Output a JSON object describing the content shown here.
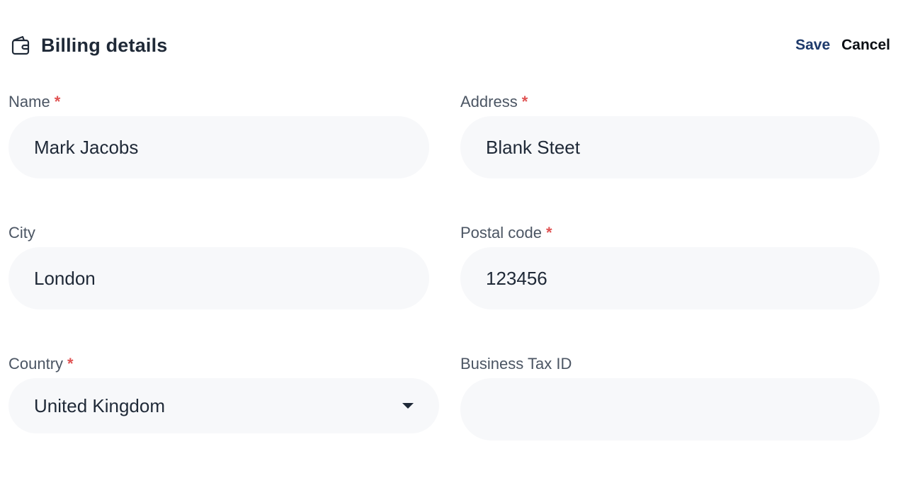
{
  "header": {
    "title": "Billing details",
    "icon": "wallet-icon",
    "save_label": "Save",
    "cancel_label": "Cancel"
  },
  "form": {
    "name": {
      "label": "Name",
      "required": "*",
      "value": "Mark Jacobs"
    },
    "address": {
      "label": "Address",
      "required": "*",
      "value": "Blank Steet"
    },
    "city": {
      "label": "City",
      "value": "London"
    },
    "postal_code": {
      "label": "Postal code",
      "required": "*",
      "value": "123456"
    },
    "country": {
      "label": "Country",
      "required": "*",
      "value": "United Kingdom",
      "icon": "caret-down-icon"
    },
    "business_tax_id": {
      "label": "Business Tax ID",
      "value": ""
    }
  },
  "colors": {
    "accent": "#1e3a6b",
    "required": "#e05353",
    "field_bg": "#f7f8fa",
    "label": "#4b5563"
  }
}
